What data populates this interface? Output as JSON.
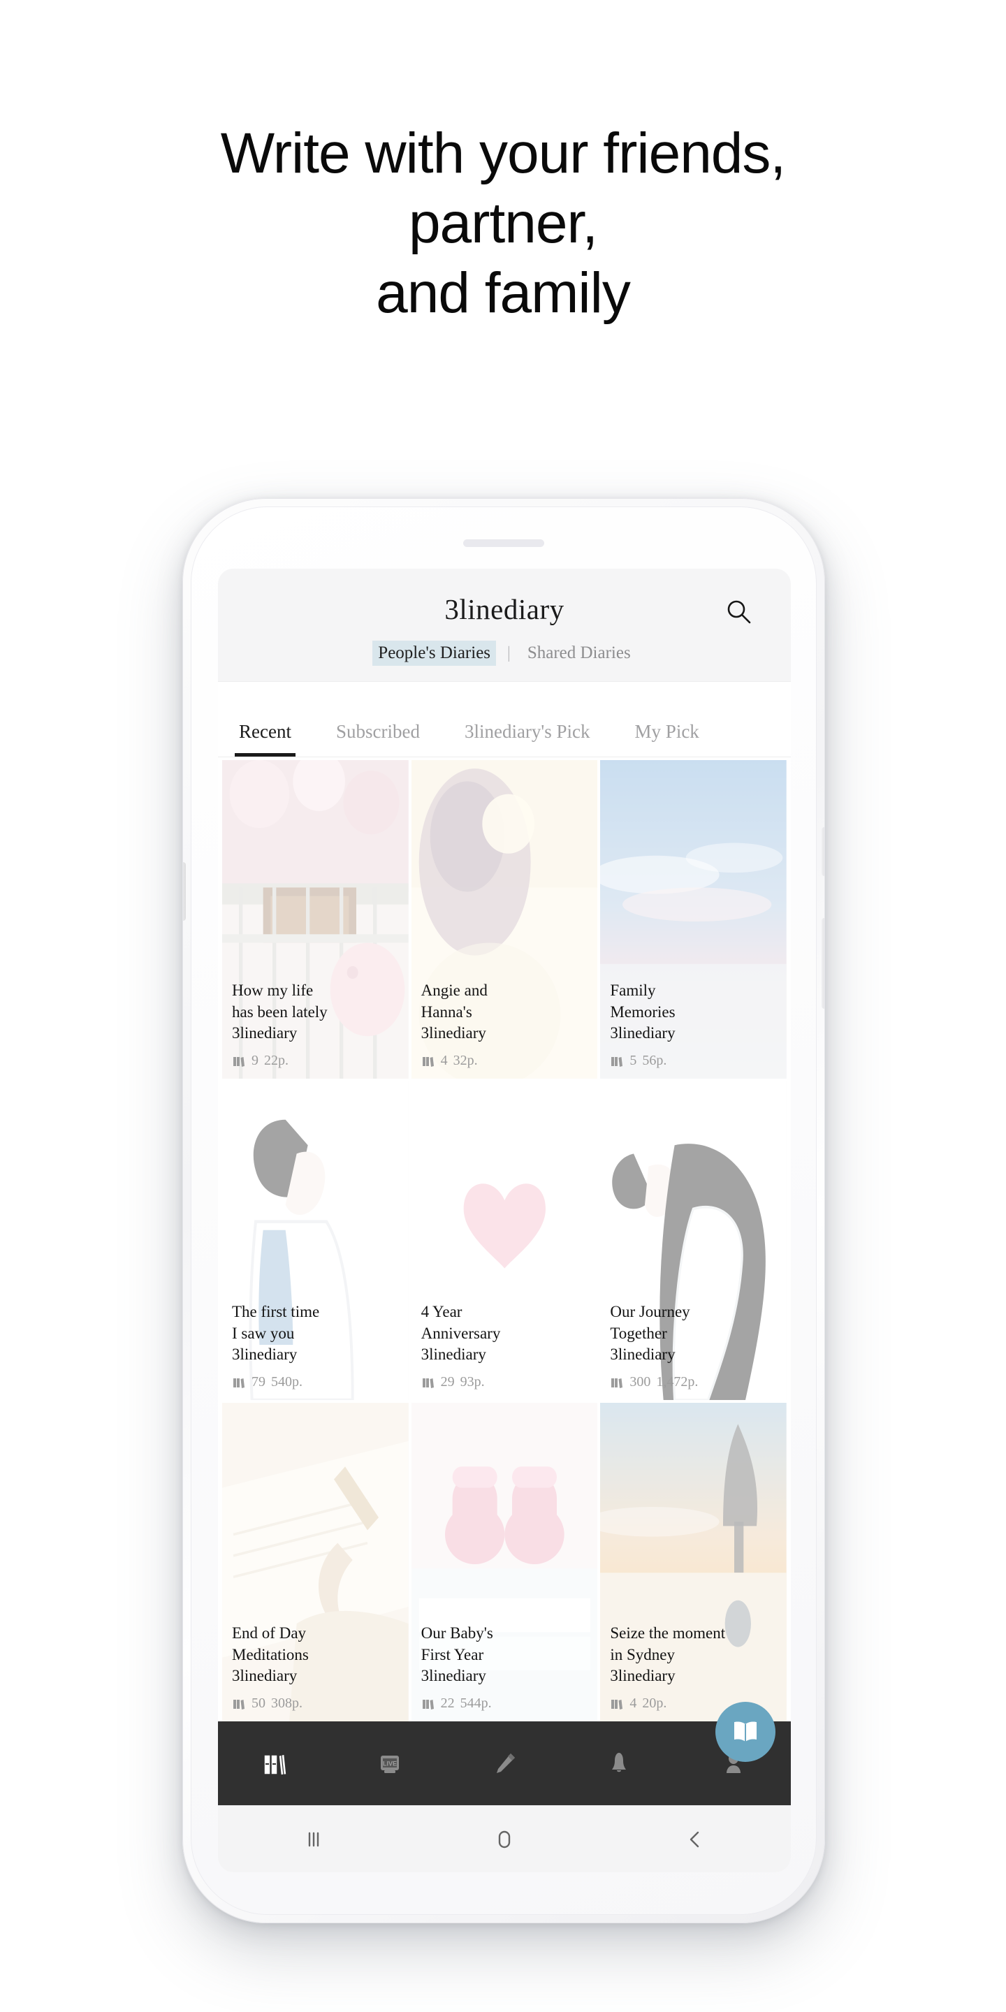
{
  "headline": {
    "line1": "Write with your friends,",
    "line2": "partner,",
    "line3": "and family"
  },
  "app": {
    "title": "3linediary",
    "search_icon": "search-icon",
    "subnav": {
      "active_label": "People's Diaries",
      "separator": "|",
      "inactive_label": "Shared Diaries"
    },
    "tabs": [
      {
        "label": "Recent",
        "active": true
      },
      {
        "label": "Subscribed",
        "active": false
      },
      {
        "label": "3linediary's Pick",
        "active": false
      },
      {
        "label": "My Pick",
        "active": false
      }
    ],
    "cards": [
      {
        "title_line1": "How my life",
        "title_line2": "has been lately",
        "author": "3linediary",
        "subscribers": "9",
        "pages": "22p.",
        "meta_icon": "books-icon"
      },
      {
        "title_line1": "Angie and",
        "title_line2": "Hanna's",
        "author": "3linediary",
        "subscribers": "4",
        "pages": "32p.",
        "meta_icon": "books-icon"
      },
      {
        "title_line1": "Family",
        "title_line2": "Memories",
        "author": "3linediary",
        "subscribers": "5",
        "pages": "56p.",
        "meta_icon": "books-icon"
      },
      {
        "title_line1": "The first time",
        "title_line2": "I saw you",
        "author": "3linediary",
        "subscribers": "79",
        "pages": "540p.",
        "meta_icon": "books-icon"
      },
      {
        "title_line1": "4 Year",
        "title_line2": "Anniversary",
        "author": "3linediary",
        "subscribers": "29",
        "pages": "93p.",
        "meta_icon": "books-icon"
      },
      {
        "title_line1": "Our Journey",
        "title_line2": "Together",
        "author": "3linediary",
        "subscribers": "300",
        "pages": "1,472p.",
        "meta_icon": "books-icon"
      },
      {
        "title_line1": "End of Day",
        "title_line2": "Meditations",
        "author": "3linediary",
        "subscribers": "50",
        "pages": "308p.",
        "meta_icon": "books-icon"
      },
      {
        "title_line1": "Our Baby's",
        "title_line2": "First Year",
        "author": "3linediary",
        "subscribers": "22",
        "pages": "544p.",
        "meta_icon": "books-icon"
      },
      {
        "title_line1": "Seize the moment",
        "title_line2": "in Sydney",
        "author": "3linediary",
        "subscribers": "4",
        "pages": "20p.",
        "meta_icon": "books-icon"
      }
    ],
    "fab": {
      "icon": "open-book-icon"
    },
    "bottom_nav": [
      {
        "icon": "books-icon",
        "active": true
      },
      {
        "icon": "live-icon",
        "active": false
      },
      {
        "icon": "pencil-icon",
        "active": false
      },
      {
        "icon": "bell-icon",
        "active": false
      },
      {
        "icon": "person-icon",
        "active": false
      }
    ]
  },
  "system_bar": [
    {
      "icon": "recents-icon"
    },
    {
      "icon": "home-icon"
    },
    {
      "icon": "back-icon"
    }
  ],
  "colors": {
    "accent_blue": "#6aa6c1",
    "subnav_highlight": "#d9e6ec",
    "bottom_nav_bg": "#303030",
    "text_primary": "#131313",
    "text_muted": "#9b9b9b"
  }
}
